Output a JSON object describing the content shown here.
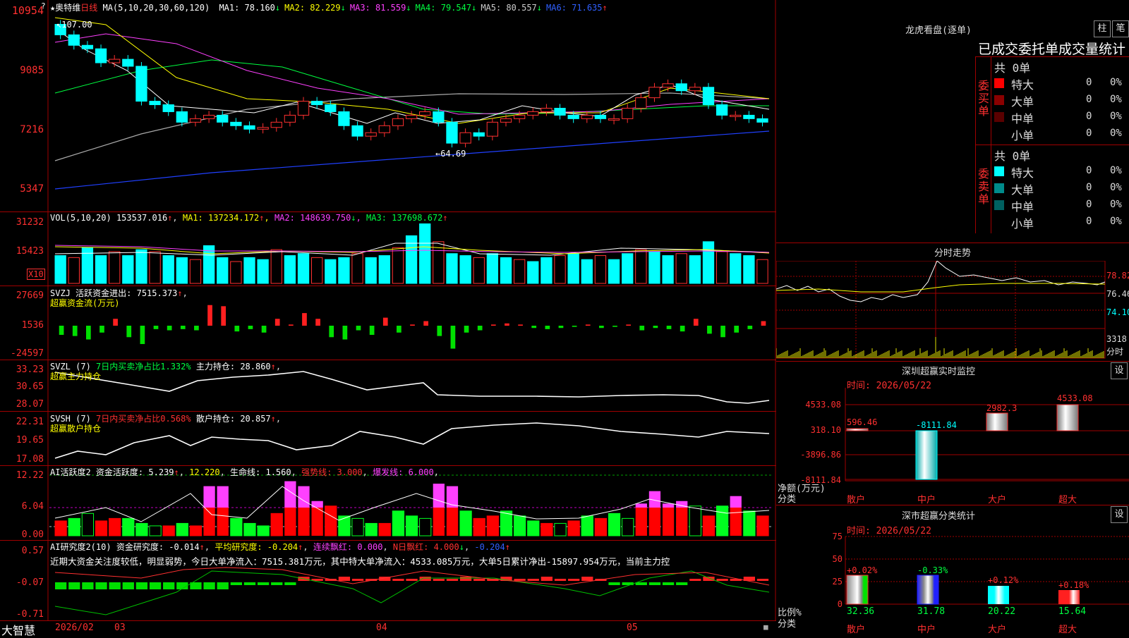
{
  "stock": {
    "name": "★奥特维",
    "period": "日线",
    "star": "?"
  },
  "main": {
    "ma_label": "MA(5,10,20,30,60,120)",
    "ma": [
      {
        "k": "MA1:",
        "v": "78.160",
        "a": "↓",
        "c": "#ffffff"
      },
      {
        "k": "MA2:",
        "v": "82.229",
        "a": "↓",
        "c": "#ffff00"
      },
      {
        "k": "MA3:",
        "v": "81.559",
        "a": "↓",
        "c": "#ff40ff"
      },
      {
        "k": "MA4:",
        "v": "79.547",
        "a": "↓",
        "c": "#00ff40"
      },
      {
        "k": "MA5:",
        "v": "80.557",
        "a": "↓",
        "c": "#cccccc"
      },
      {
        "k": "MA6:",
        "v": "71.635",
        "a": "↑",
        "c": "#3060ff"
      }
    ],
    "y_labels": [
      "10954",
      "9085",
      "7216",
      "5347"
    ],
    "hi_label": "107.00",
    "lo_label": "64.69"
  },
  "vol": {
    "title": "VOL(5,10,20)",
    "v": "153537.016",
    "ma1": "137234.172",
    "ma2": "148639.750",
    "ma3": "137698.672",
    "y_labels": [
      "31232",
      "15423"
    ],
    "unit": "X10"
  },
  "svzj": {
    "title": "SVZJ",
    "desc": "活跃资金进出:",
    "v": "7515.373",
    "sub": "超赢资金流(万元)",
    "y_labels": [
      "27669",
      "1536",
      "-24597"
    ]
  },
  "svzl": {
    "title": "SVZL (7)",
    "desc": "7日内买卖净占比1.332%",
    "k": "主力持仓:",
    "v": "28.860",
    "sub": "超赢主力持仓",
    "y_labels": [
      "33.23",
      "30.65",
      "28.07"
    ]
  },
  "svsh": {
    "title": "SVSH (7)",
    "desc": "7日内买卖净占比0.568%",
    "k": "散户持仓:",
    "v": "20.857",
    "sub": "超赢散户持仓",
    "y_labels": [
      "22.31",
      "19.65",
      "17.08"
    ]
  },
  "ai1": {
    "title": "AI活跃度2",
    "k1": "资金活跃度:",
    "v1": "5.239",
    "v2": "12.220",
    "k3": "生命线:",
    "v3": "1.560",
    "k4": "强势线:",
    "v4": "3.000",
    "k5": "爆发线:",
    "v5": "6.000",
    "y_labels": [
      "12.22",
      "6.04",
      "0.00"
    ]
  },
  "ai2": {
    "title": "AI研究度2(10)",
    "k1": "资金研究度:",
    "v1": "-0.014",
    "k2": "平均研究度:",
    "v2": "-0.204",
    "k3": "连续飘红:",
    "v3": "0.000",
    "k4": "N日飘红:",
    "v4": "4.000",
    "v5": "-0.204",
    "note": "近期大资金关注度较低，明显弱势，今日大单净流入：7515.381万元，其中特大单净流入：4533.085万元，大单5日累计净出-15897.954万元，当前主力控",
    "y_labels": [
      "0.57",
      "-0.07",
      "-0.71"
    ]
  },
  "xaxis": {
    "brand": "大智慧",
    "labels": [
      "2026/02",
      "03",
      "04",
      "05"
    ]
  },
  "lhb": {
    "title": "龙虎看盘(逐单)",
    "btn1": "柱",
    "btn2": "笔",
    "subtitle": "已成交委托单成交量统计",
    "buy": {
      "side": "委买单",
      "total": "共 0单",
      "rows": [
        {
          "n": "特大",
          "q": "0",
          "p": "0%",
          "c": "#ff0000"
        },
        {
          "n": "大单",
          "q": "0",
          "p": "0%",
          "c": "#8b0000"
        },
        {
          "n": "中单",
          "q": "0",
          "p": "0%",
          "c": "#5a0000"
        },
        {
          "n": "小单",
          "q": "0",
          "p": "0%",
          "c": ""
        }
      ]
    },
    "sell": {
      "side": "委卖单",
      "total": "共 0单",
      "rows": [
        {
          "n": "特大",
          "q": "0",
          "p": "0%",
          "c": "#00ffff"
        },
        {
          "n": "大单",
          "q": "0",
          "p": "0%",
          "c": "#008b8b"
        },
        {
          "n": "中单",
          "q": "0",
          "p": "0%",
          "c": "#006060"
        },
        {
          "n": "小单",
          "q": "0",
          "p": "0%",
          "c": ""
        }
      ]
    }
  },
  "fenshi": {
    "title": "分时走势",
    "y_labels": [
      "78.82",
      "76.46",
      "74.10"
    ],
    "vol": "3318",
    "unit": "分时"
  },
  "sz_monitor": {
    "title": "深圳超赢实时监控",
    "btn": "设",
    "time": "时间: 2026/05/22",
    "y_labels": [
      "4533.08",
      "318.10",
      "-3896.86",
      "-8111.84"
    ],
    "ylabel1": "净额(万元)",
    "ylabel2": "分类",
    "cats": [
      "散户",
      "中户",
      "大户",
      "超大"
    ],
    "values": [
      "596.46",
      "-8111.84",
      "2982.3",
      "4533.08"
    ]
  },
  "sz_class": {
    "title": "深市超赢分类统计",
    "btn": "设",
    "time": "时间: 2026/05/22",
    "y_labels": [
      "75",
      "50",
      "25",
      "0"
    ],
    "ylabel1": "比例%",
    "ylabel2": "分类",
    "cats": [
      "散户",
      "中户",
      "大户",
      "超大"
    ],
    "pcts": [
      "32.36",
      "31.78",
      "20.22",
      "15.64"
    ],
    "chg": [
      "+0.02%",
      "-0.33%",
      "+0.12%",
      "+0.18%"
    ]
  },
  "chart_data": [
    {
      "type": "candlestick",
      "title": "日线",
      "ylim": [
        5347,
        10954
      ],
      "note": "sampled closes",
      "values": [
        10200,
        9900,
        9800,
        9400,
        9500,
        9300,
        8300,
        8200,
        8000,
        7700,
        7800,
        7900,
        7700,
        7600,
        7500,
        7550,
        7700,
        7900,
        8300,
        8200,
        8000,
        7600,
        7300,
        7400,
        7600,
        7800,
        7900,
        8000,
        7700,
        7100,
        7400,
        7300,
        7700,
        7800,
        7900,
        8000,
        8100,
        7900,
        7800,
        7900,
        7800,
        7800,
        8100,
        8400,
        8700,
        8800,
        8600,
        8700,
        8200,
        7900,
        7900,
        7800,
        7700
      ]
    },
    {
      "type": "bar",
      "title": "VOL",
      "ylim": [
        0,
        31232
      ],
      "values": [
        14000,
        13000,
        18000,
        14000,
        16000,
        14000,
        17000,
        16000,
        14000,
        13000,
        12000,
        19000,
        13000,
        11000,
        13000,
        12000,
        17000,
        14000,
        15000,
        13000,
        12000,
        13000,
        15000,
        13000,
        14000,
        18000,
        24000,
        30000,
        21000,
        15000,
        14000,
        13000,
        15000,
        13000,
        12000,
        11000,
        13000,
        14000,
        15000,
        12000,
        14000,
        12000,
        15000,
        17000,
        16000,
        14000,
        15000,
        14000,
        21000,
        16000,
        15000,
        14000,
        12000
      ]
    },
    {
      "type": "bar",
      "title": "SVZJ",
      "ylim": [
        -24597,
        27669
      ],
      "values": [
        -8000,
        -9000,
        -12000,
        -6000,
        6000,
        -10000,
        -16000,
        -3000,
        -4000,
        -3000,
        -4000,
        18000,
        17000,
        -5000,
        -3000,
        -6000,
        6000,
        1000,
        11000,
        6000,
        -10000,
        -12000,
        -4000,
        -8000,
        7000,
        -6000,
        1000,
        4000,
        -9000,
        -20000,
        -6000,
        -4000,
        1000,
        2000,
        1000,
        -2000,
        -3000,
        -2000,
        -1000,
        1000,
        -2000,
        -1000,
        1000,
        -4000,
        -2000,
        -3000,
        -5000,
        6000,
        -7000,
        -10000,
        -6000,
        -3000,
        4000
      ]
    },
    {
      "type": "bar",
      "title": "AI活跃度2",
      "ylim": [
        0,
        12.22
      ],
      "values": [
        3,
        3.5,
        4.5,
        3,
        3.5,
        3.5,
        2.5,
        2,
        2,
        2.5,
        2,
        10,
        10,
        3.5,
        2.5,
        2,
        4.5,
        11,
        10,
        7,
        6,
        4,
        3.5,
        2.5,
        2.5,
        5,
        4,
        3.5,
        10.5,
        10,
        5,
        3.5,
        4,
        5,
        4,
        3,
        2.5,
        2.5,
        3,
        4,
        3.5,
        4.5,
        3.5,
        6.5,
        9,
        6.5,
        7,
        6,
        4,
        6,
        8,
        5,
        4
      ]
    }
  ]
}
